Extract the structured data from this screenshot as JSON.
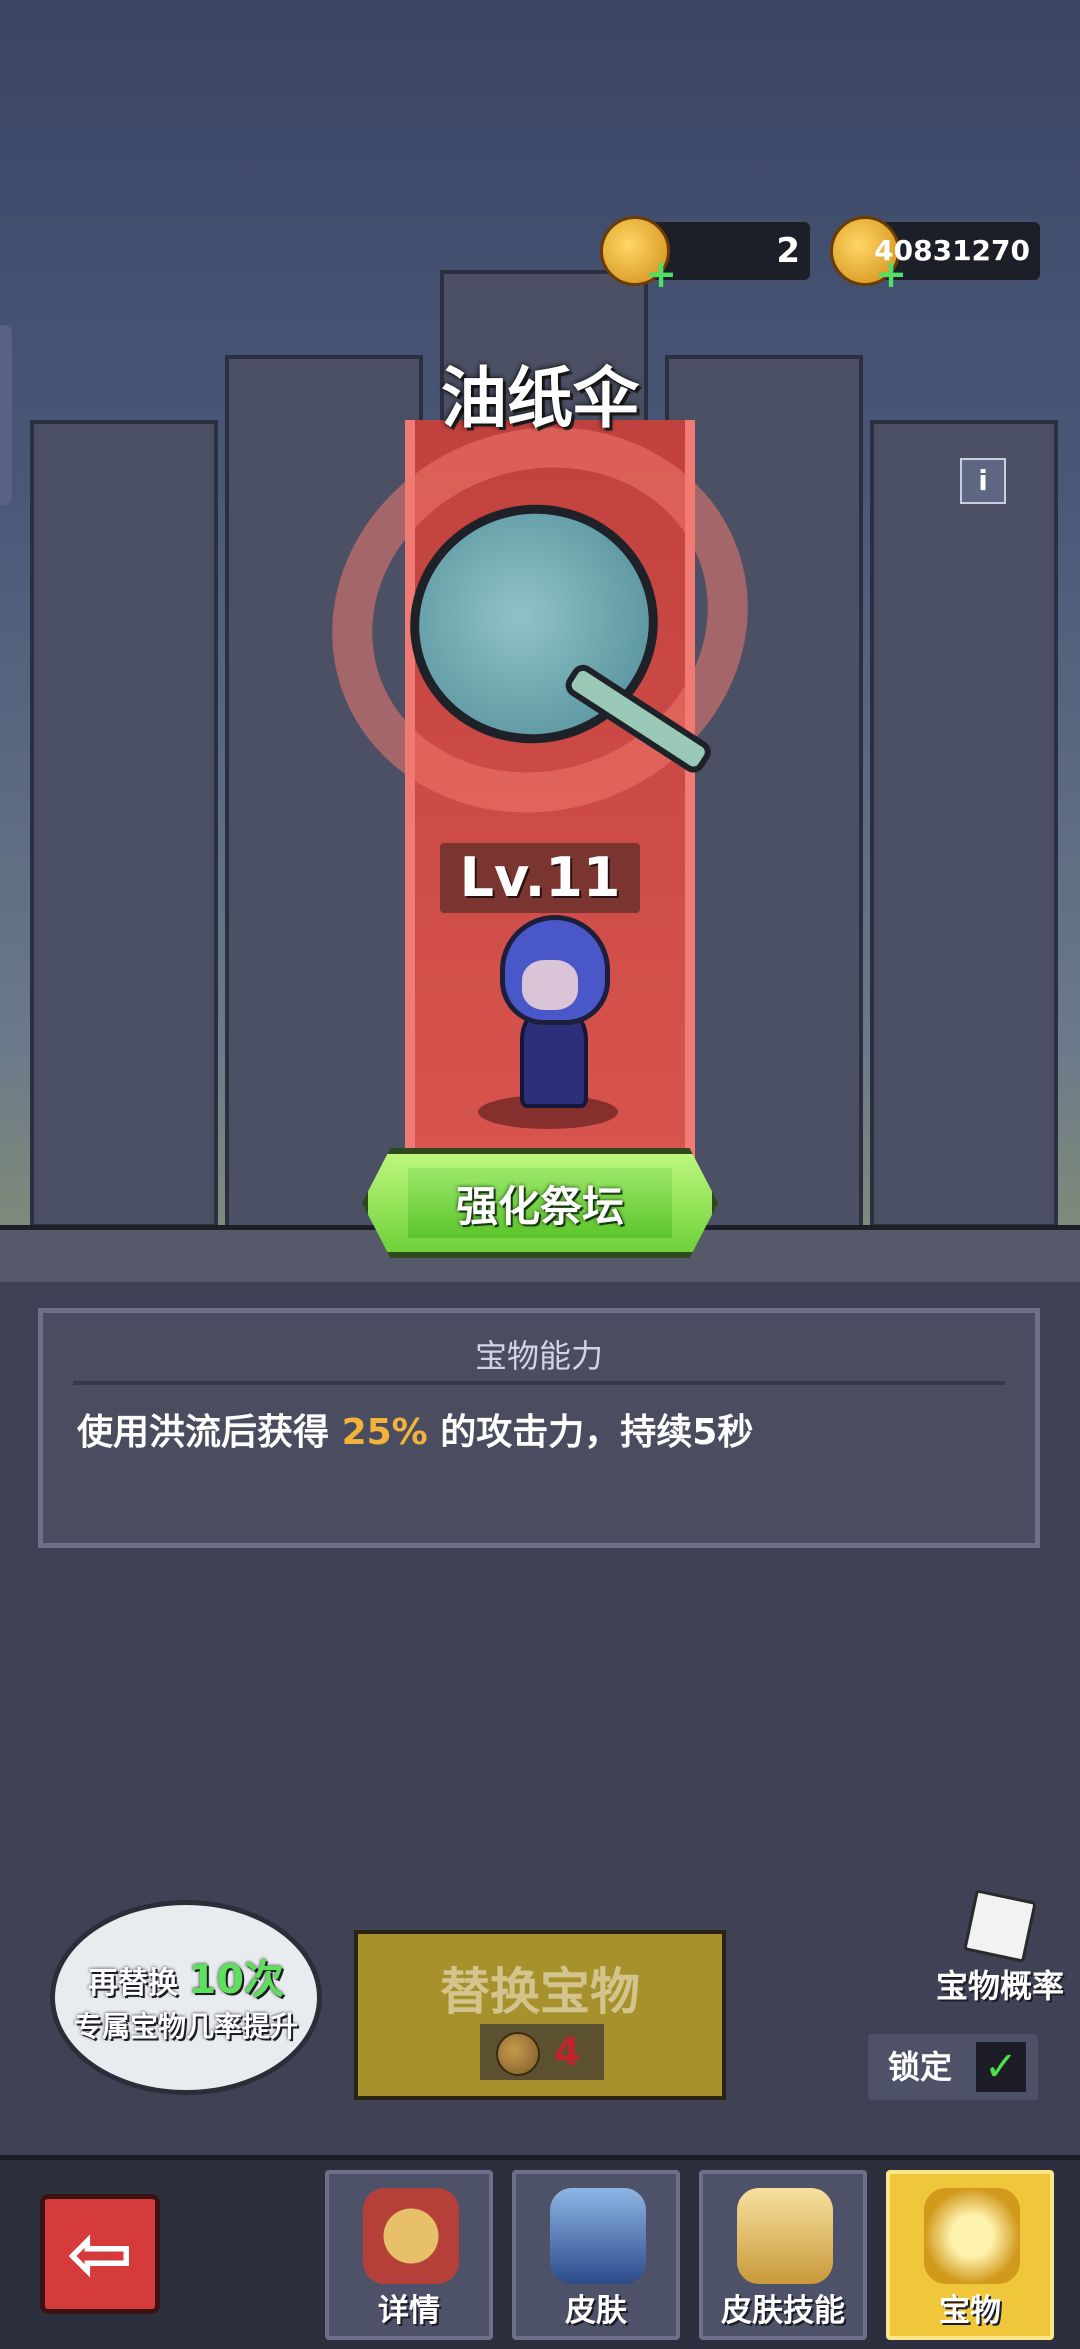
{
  "currencies": [
    {
      "name": "gem-currency",
      "value": "2"
    },
    {
      "name": "gold-currency",
      "value": "40831270"
    }
  ],
  "treasure": {
    "name": "油纸伞",
    "level": "Lv.11",
    "info_label": "i"
  },
  "altar_button": "强化祭坛",
  "ability": {
    "title": "宝物能力",
    "prefix": "使用洪流后获得",
    "highlight": "25%",
    "suffix": "的攻击力，持续5秒"
  },
  "hint_bubble": {
    "line1_prefix": "再替换",
    "line1_count": "10次",
    "line2": "专属宝物几率提升"
  },
  "replace_button": {
    "label": "替换宝物",
    "cost": "4"
  },
  "probability_button": "宝物概率",
  "lock": {
    "label": "锁定",
    "checked": true
  },
  "nav": {
    "back_icon": "arrow-left-icon",
    "tabs": [
      {
        "label": "详情",
        "active": false
      },
      {
        "label": "皮肤",
        "active": false
      },
      {
        "label": "皮肤技能",
        "active": false
      },
      {
        "label": "宝物",
        "active": true
      }
    ]
  },
  "colors": {
    "highlight": "#f3b33a",
    "accent_green": "#6fd13a",
    "active_tab": "#f0c73a"
  }
}
